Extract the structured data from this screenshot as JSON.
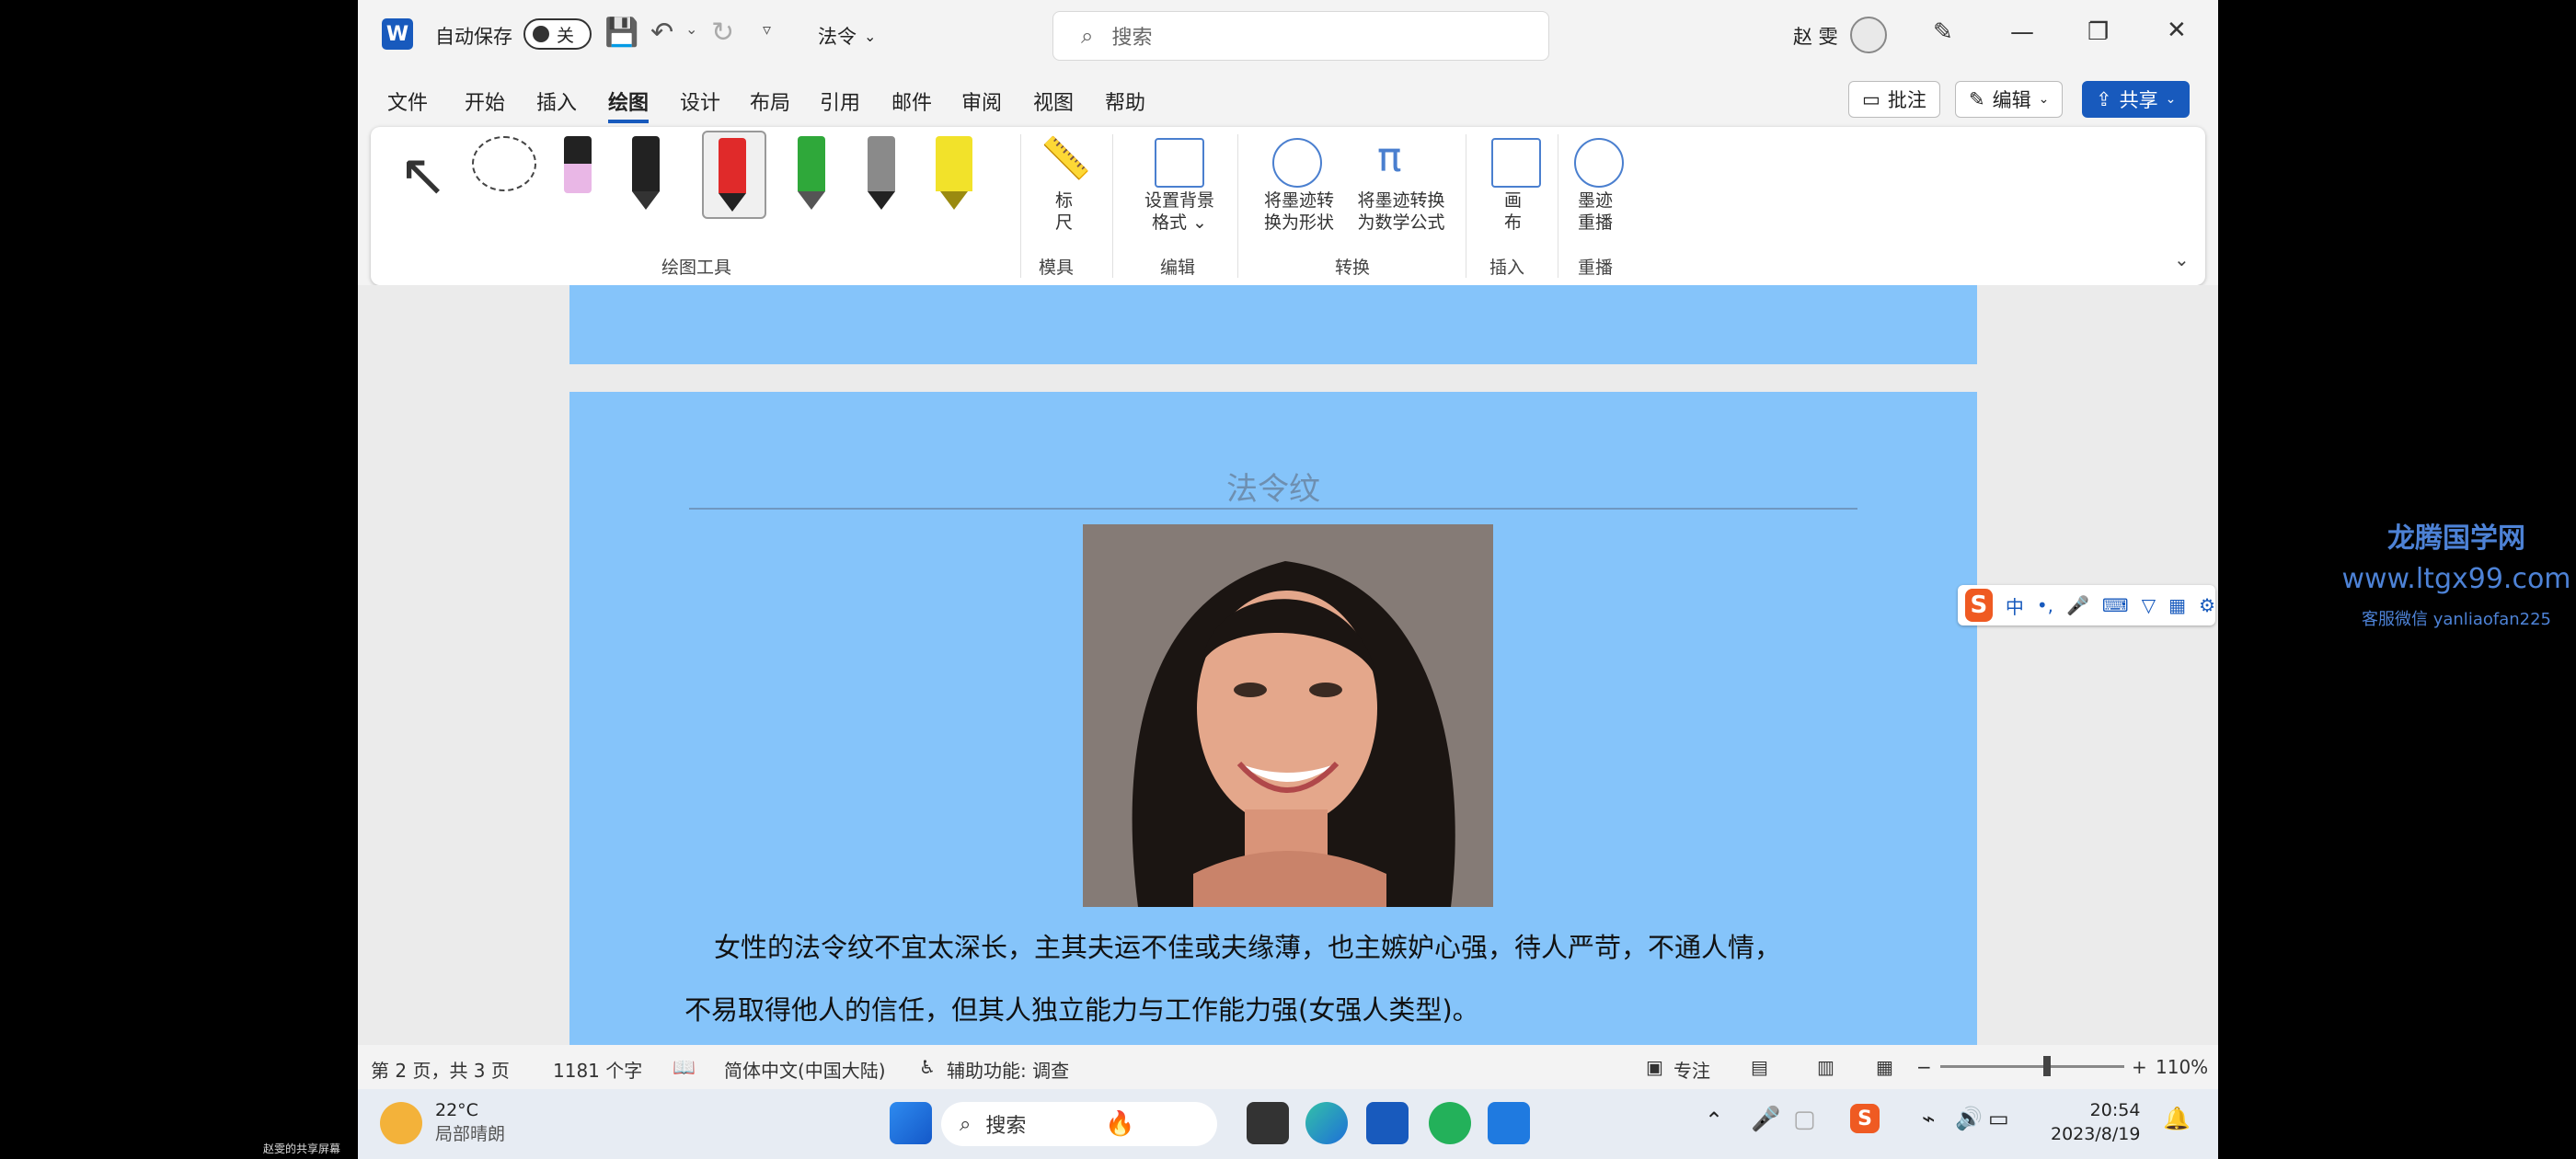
{
  "title_bar": {
    "app_logo": "W",
    "autosave_label": "自动保存",
    "autosave_state": "关",
    "doc_title": "法令",
    "search_placeholder": "搜索",
    "user_name": "赵 雯"
  },
  "ribbon_tabs": [
    "文件",
    "开始",
    "插入",
    "绘图",
    "设计",
    "布局",
    "引用",
    "邮件",
    "审阅",
    "视图",
    "帮助"
  ],
  "active_tab": "绘图",
  "header_buttons": {
    "comment": "批注",
    "edit": "编辑",
    "share": "共享"
  },
  "ribbon": {
    "group_drawing_tools": "绘图工具",
    "ruler_label_1": "标",
    "ruler_label_2": "尺",
    "group_template": "模具",
    "bg_format_label_1": "设置背景",
    "bg_format_label_2": "格式",
    "group_edit": "编辑",
    "ink_to_shape_1": "将墨迹转",
    "ink_to_shape_2": "换为形状",
    "ink_to_math_1": "将墨迹转换",
    "ink_to_math_2": "为数学公式",
    "group_convert": "转换",
    "canvas_1": "画",
    "canvas_2": "布",
    "group_insert": "插入",
    "replay_1": "墨迹",
    "replay_2": "重播",
    "group_replay": "重播",
    "pen_colors": [
      "#e9b7e6",
      "#222222",
      "#e02a2a",
      "#2fa83a",
      "#8a8a8a",
      "#f2e22a"
    ]
  },
  "document": {
    "heading": "法令纹",
    "para_line1": "女性的法令纹不宜太深长，主其夫运不佳或夫缘薄，也主嫉妒心强，待人严苛，不通人情，",
    "para_line2": "不易取得他人的信任，但其人独立能力与工作能力强(女强人类型)。"
  },
  "status_bar": {
    "page_info": "第 2 页，共 3 页",
    "word_count": "1181 个字",
    "language": "简体中文(中国大陆)",
    "accessibility": "辅助功能: 调查",
    "focus": "专注",
    "zoom": "110%",
    "zoom_fraction": 0.56
  },
  "taskbar": {
    "weather_temp": "22°C",
    "weather_desc": "局部晴朗",
    "search_label": "搜索",
    "time": "20:54",
    "date": "2023/8/19"
  },
  "ime": {
    "logo": "S",
    "mode": "中"
  },
  "watermark": {
    "line1": "龙腾国学网",
    "line2": "www.ltgx99.com",
    "line3": "客服微信 yanliaofan225"
  },
  "corner_label": "赵雯的共享屏幕"
}
